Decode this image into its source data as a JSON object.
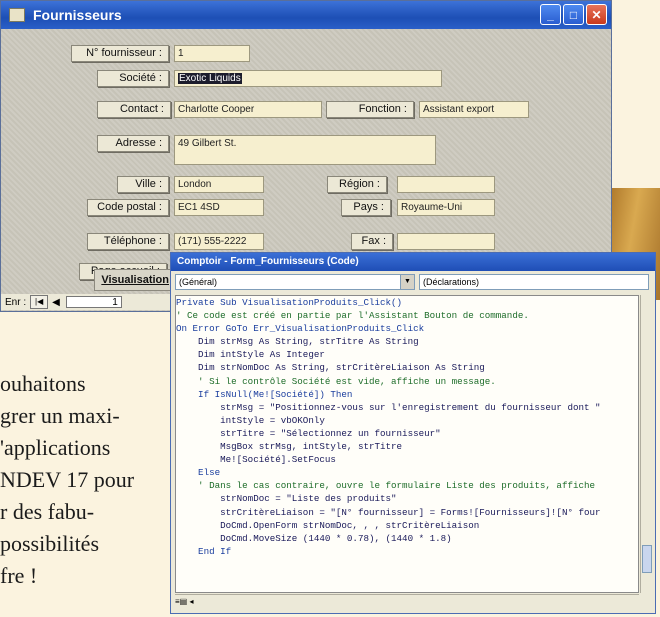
{
  "form": {
    "title": "Fournisseurs",
    "window_buttons": {
      "minimize": "_",
      "maximize": "□",
      "close": "✕"
    },
    "fields": {
      "supplier_no": {
        "label": "N° fournisseur :",
        "value": "1"
      },
      "societe": {
        "label": "Société :",
        "value": "Exotic Liquids"
      },
      "contact": {
        "label": "Contact :",
        "value": "Charlotte Cooper"
      },
      "fonction": {
        "label": "Fonction :",
        "value": "Assistant export"
      },
      "adresse": {
        "label": "Adresse :",
        "value": "49 Gilbert St."
      },
      "ville": {
        "label": "Ville :",
        "value": "London"
      },
      "region": {
        "label": "Région :",
        "value": ""
      },
      "code_postal": {
        "label": "Code postal :",
        "value": "EC1 4SD"
      },
      "pays": {
        "label": "Pays :",
        "value": "Royaume-Uni"
      },
      "telephone": {
        "label": "Téléphone :",
        "value": "(171) 555-2222"
      },
      "fax": {
        "label": "Fax :",
        "value": ""
      },
      "page_accueil": {
        "label": "Page accueil :",
        "value": ""
      }
    },
    "visualisation_button": "Visualisation",
    "nav": {
      "label": "Enr :",
      "first": "|◀",
      "prev": "◀",
      "current": "1"
    }
  },
  "code_window": {
    "title": "Comptoir - Form_Fournisseurs (Code)",
    "object_combo": "(Général)",
    "proc_combo": "(Déclarations)",
    "lines": [
      {
        "text": "Private Sub VisualisationProduits_Click()",
        "kind": "kw"
      },
      {
        "text": "' Ce code est créé en partie par l'Assistant Bouton de commande.",
        "kind": "cmt"
      },
      {
        "text": "On Error GoTo Err_VisualisationProduits_Click",
        "kind": "kw"
      },
      {
        "text": "",
        "kind": "code"
      },
      {
        "text": "    Dim strMsg As String, strTitre As String",
        "kind": "code"
      },
      {
        "text": "    Dim intStyle As Integer",
        "kind": "code"
      },
      {
        "text": "    Dim strNomDoc As String, strCritèreLiaison As String",
        "kind": "code"
      },
      {
        "text": "",
        "kind": "code"
      },
      {
        "text": "    ' Si le contrôle Société est vide, affiche un message.",
        "kind": "cmt"
      },
      {
        "text": "    If IsNull(Me![Société]) Then",
        "kind": "kw"
      },
      {
        "text": "        strMsg = \"Positionnez-vous sur l'enregistrement du fournisseur dont \"",
        "kind": "code"
      },
      {
        "text": "        intStyle = vbOKOnly",
        "kind": "code"
      },
      {
        "text": "        strTitre = \"Sélectionnez un fournisseur\"",
        "kind": "code"
      },
      {
        "text": "        MsgBox strMsg, intStyle, strTitre",
        "kind": "code"
      },
      {
        "text": "        Me![Société].SetFocus",
        "kind": "code"
      },
      {
        "text": "    Else",
        "kind": "kw"
      },
      {
        "text": "    ' Dans le cas contraire, ouvre le formulaire Liste des produits, affiche",
        "kind": "cmt"
      },
      {
        "text": "        strNomDoc = \"Liste des produits\"",
        "kind": "code"
      },
      {
        "text": "        strCritèreLiaison = \"[N° fournisseur] = Forms![Fournisseurs]![N° four",
        "kind": "code"
      },
      {
        "text": "        DoCmd.OpenForm strNomDoc, , , strCritèreLiaison",
        "kind": "code"
      },
      {
        "text": "        DoCmd.MoveSize (1440 * 0.78), (1440 * 1.8)",
        "kind": "code"
      },
      {
        "text": "    End If",
        "kind": "kw"
      }
    ],
    "hscroll_label": "≡▤ ◂"
  },
  "article_text": [
    "ouhaitons",
    "grer un maxi-",
    "'applications",
    "NDEV 17 pour",
    "r des fabu-",
    "possibilités",
    "fre !"
  ]
}
